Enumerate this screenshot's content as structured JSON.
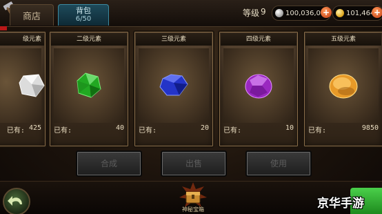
{
  "tabs": {
    "shop": {
      "label": "商店"
    },
    "bag": {
      "title": "背包",
      "count": "6/50"
    }
  },
  "player": {
    "level_label": "等级",
    "level": "9",
    "silver": "100,036,0",
    "gold": "101,464,"
  },
  "owned_prefix": "已有:",
  "cards": [
    {
      "name": "级元素",
      "count": "425",
      "gem": "white-gem-icon",
      "color": "#e8e8e8"
    },
    {
      "name": "二级元素",
      "count": "40",
      "gem": "green-gem-icon",
      "color": "#2db82d"
    },
    {
      "name": "三级元素",
      "count": "20",
      "gem": "blue-gem-icon",
      "color": "#3040d8"
    },
    {
      "name": "四级元素",
      "count": "10",
      "gem": "purple-gem-icon",
      "color": "#a030c8"
    },
    {
      "name": "五级元素",
      "count": "9850",
      "gem": "gold-gem-icon",
      "color": "#f0a830"
    }
  ],
  "actions": {
    "button_1": "合成",
    "button_2": "出售",
    "button_3": "使用"
  },
  "bottom": {
    "chest_label": "神秘宝箱",
    "watermark": "京华手游"
  },
  "colors": {
    "accent_tab": "#1e4a5a",
    "plus_button": "#c33a10",
    "notify": "#b81818",
    "green_button": "#2ea82e"
  }
}
